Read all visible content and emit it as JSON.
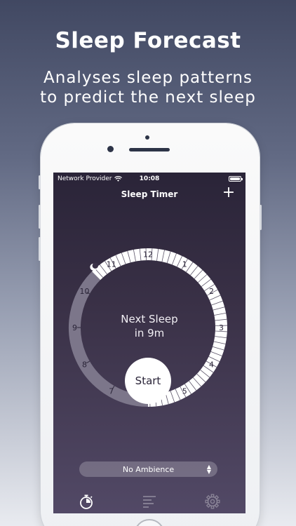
{
  "promo": {
    "headline": "Sleep Forecast",
    "subline_1": "Analyses sleep patterns",
    "subline_2": "to predict the next sleep"
  },
  "status_bar": {
    "carrier": "Network Provider",
    "time": "10:08",
    "wifi_icon": "wifi-icon",
    "battery_icon": "battery-icon"
  },
  "nav": {
    "title": "Sleep Timer",
    "add_label": "+"
  },
  "dial": {
    "hour_labels": [
      "12",
      "1",
      "2",
      "3",
      "4",
      "5",
      "6",
      "7",
      "8",
      "9",
      "10",
      "11"
    ],
    "marker_icon": "moon-marker-icon"
  },
  "forecast": {
    "line_1": "Next Sleep",
    "line_2": "in 9m"
  },
  "start_button": {
    "label": "Start"
  },
  "ambience": {
    "selected": "No Ambience",
    "arrows_icon": "chevron-up-down-icon"
  },
  "tabbar": {
    "items": [
      {
        "icon": "stopwatch-icon",
        "active": true
      },
      {
        "icon": "stats-icon",
        "active": false
      },
      {
        "icon": "gear-icon",
        "active": false
      }
    ]
  },
  "colors": {
    "screen_bg": "#2a2438",
    "ring_grey": "#7c768a",
    "ring_white": "#ffffff",
    "text_white": "#ffffff"
  }
}
